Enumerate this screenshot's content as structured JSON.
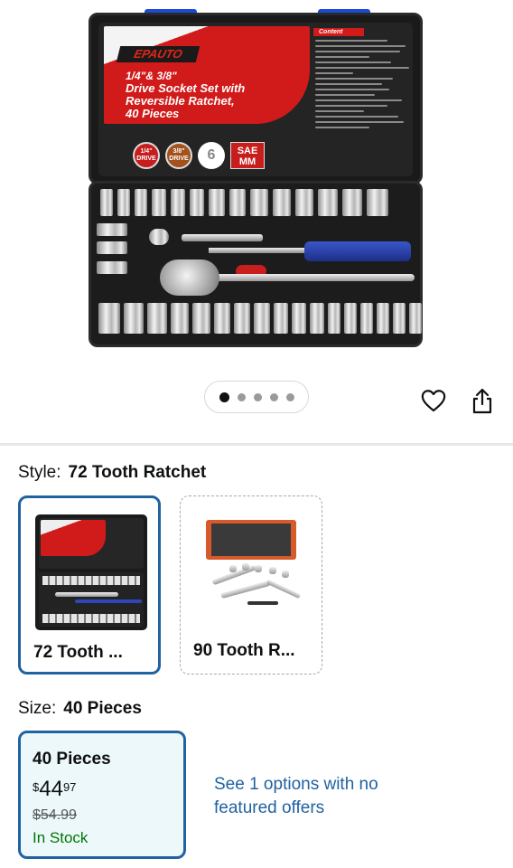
{
  "product_image": {
    "brand": "EPAUTO",
    "headline_line1": "1/4\"& 3/8\"",
    "headline_line2": "Drive Socket Set with",
    "headline_line3": "Reversible Ratchet,",
    "headline_line4": "40 Pieces",
    "content_label": "Content",
    "badge_1": "1/4\" DRIVE",
    "badge_2": "3/8\" DRIVE",
    "badge_3": "6",
    "badge_4": "SAE MM"
  },
  "carousel": {
    "total": 5,
    "active_index": 0
  },
  "actions": {
    "favorite_icon": "heart-icon",
    "share_icon": "share-icon"
  },
  "style": {
    "label": "Style:",
    "selected_value": "72 Tooth Ratchet",
    "options": [
      {
        "caption": "72 Tooth ...",
        "selected": true
      },
      {
        "caption": "90 Tooth R...",
        "selected": false
      }
    ]
  },
  "size": {
    "label": "Size:",
    "selected_value": "40 Pieces",
    "option": {
      "name": "40 Pieces",
      "currency": "$",
      "price_whole": "44",
      "price_fraction": "97",
      "list_price": "$54.99",
      "availability": "In Stock"
    },
    "see_more": "See 1 options with no featured offers"
  },
  "colors": {
    "accent_blue": "#2162a1",
    "in_stock_green": "#007600",
    "selected_bg": "#edf8fb"
  }
}
